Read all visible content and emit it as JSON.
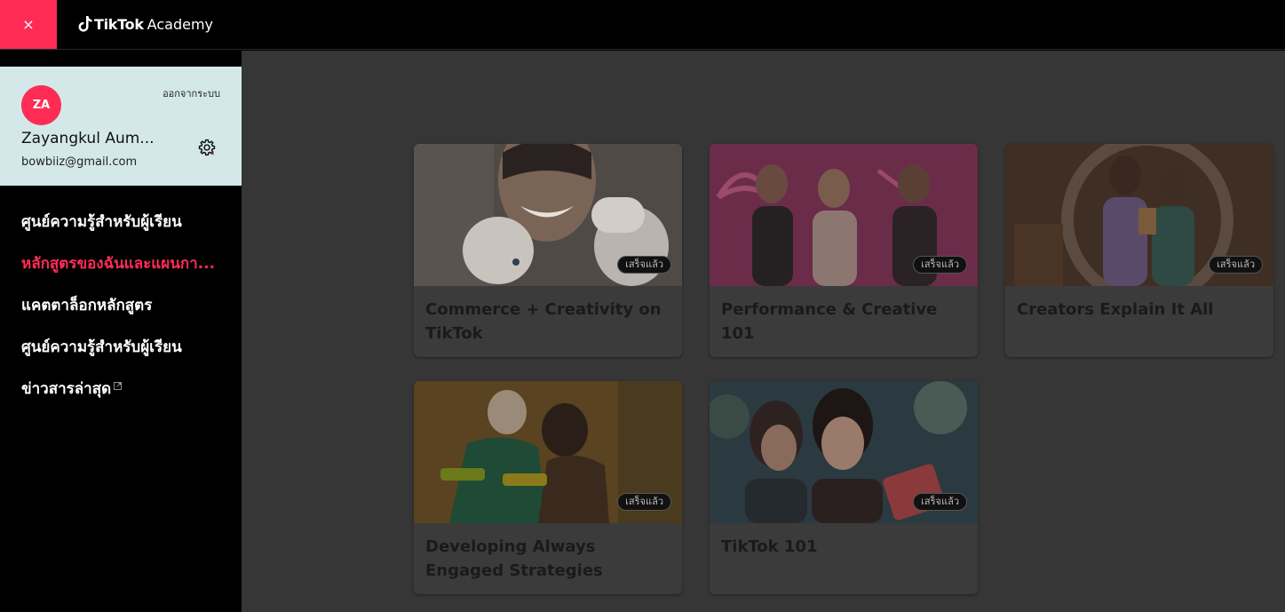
{
  "header": {
    "close_label": "×",
    "brand_name": "TikTok",
    "brand_sub": "Academy"
  },
  "profile": {
    "initials": "ZA",
    "name": "Zayangkul Aum...",
    "email": "bowbiiz@gmail.com",
    "logout_label": "ออกจากระบบ"
  },
  "nav": {
    "items": [
      {
        "label": "ศูนย์ความรู้สำหรับผู้เรียน"
      },
      {
        "label": "หลักสูตรของฉันและแผนกา..."
      },
      {
        "label": "แคตตาล็อกหลักสูตร"
      },
      {
        "label": "ศูนย์ความรู้สำหรับผู้เรียน"
      },
      {
        "label": "ข่าวสารล่าสุด"
      }
    ]
  },
  "courses": [
    {
      "title": "Commerce + Creativity on TikTok",
      "status": "เสร็จแล้ว"
    },
    {
      "title": "Performance & Creative 101",
      "status": "เสร็จแล้ว"
    },
    {
      "title": "Creators Explain It All",
      "status": "เสร็จแล้ว"
    },
    {
      "title": "Developing Always Engaged Strategies",
      "status": "เสร็จแล้ว"
    },
    {
      "title": "TikTok 101",
      "status": "เสร็จแล้ว"
    }
  ],
  "colors": {
    "accent": "#fe2c55",
    "profile_bg": "#d4e8ea",
    "overlay_bg": "#363636"
  }
}
